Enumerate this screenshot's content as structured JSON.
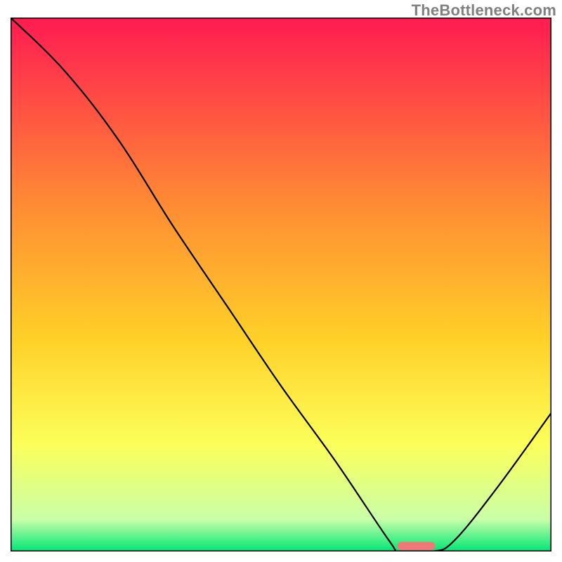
{
  "watermark": "TheBottleneck.com",
  "chart_data": {
    "type": "line",
    "title": "",
    "xlabel": "",
    "ylabel": "",
    "xlim": [
      0,
      1
    ],
    "ylim": [
      0,
      1
    ],
    "background_gradient": {
      "stops": [
        {
          "offset": 0.0,
          "color": "#ff1b52"
        },
        {
          "offset": 0.35,
          "color": "#ff8b34"
        },
        {
          "offset": 0.6,
          "color": "#ffd028"
        },
        {
          "offset": 0.8,
          "color": "#fcff5a"
        },
        {
          "offset": 0.94,
          "color": "#c9ffa8"
        },
        {
          "offset": 1.0,
          "color": "#00e676"
        }
      ]
    },
    "series": [
      {
        "name": "bottleneck-curve",
        "stroke": "#000000",
        "x": [
          0.0,
          0.1,
          0.2,
          0.3,
          0.4,
          0.5,
          0.6,
          0.7,
          0.72,
          0.78,
          0.82,
          0.9,
          1.0
        ],
        "y": [
          1.0,
          0.9,
          0.77,
          0.61,
          0.46,
          0.31,
          0.17,
          0.02,
          0.0,
          0.0,
          0.02,
          0.12,
          0.26
        ]
      }
    ],
    "marker": {
      "name": "optimal-zone",
      "shape": "rounded-bar",
      "color": "#ef7878",
      "x_center": 0.75,
      "x_half_width": 0.035,
      "y": 0.01
    },
    "border": "#000000"
  }
}
